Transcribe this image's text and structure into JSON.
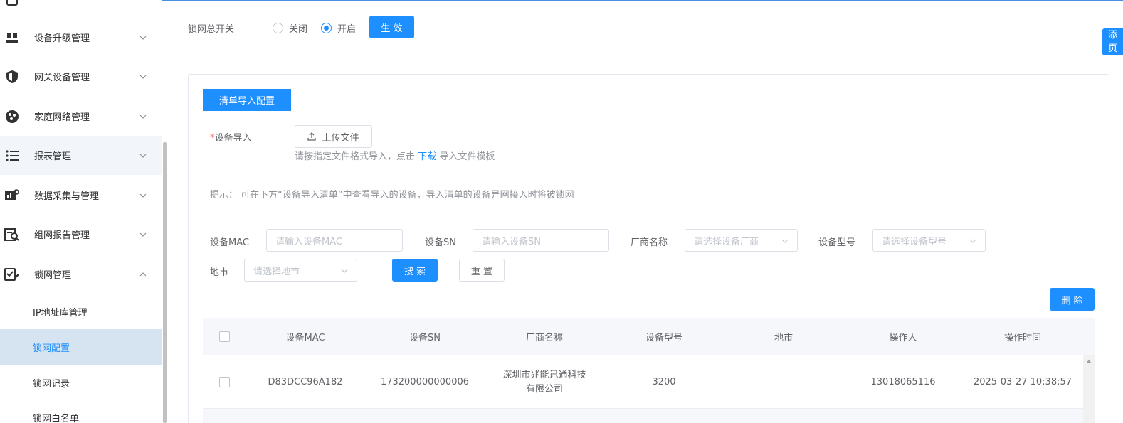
{
  "sidebar": {
    "items": [
      {
        "label": "设备升级管理",
        "icon": "package-icon"
      },
      {
        "label": "网关设备管理",
        "icon": "shield-icon"
      },
      {
        "label": "家庭网络管理",
        "icon": "network-icon"
      },
      {
        "label": "报表管理",
        "icon": "list-icon"
      },
      {
        "label": "数据采集与管理",
        "icon": "data-collect-icon"
      },
      {
        "label": "组网报告管理",
        "icon": "report-search-icon"
      },
      {
        "label": "锁网管理",
        "icon": "lock-config-icon"
      }
    ],
    "sub_items": [
      {
        "label": "IP地址库管理"
      },
      {
        "label": "锁网配置"
      },
      {
        "label": "锁网记录"
      },
      {
        "label": "锁网白名单"
      }
    ]
  },
  "lock_switch": {
    "label": "锁网总开关",
    "off_label": "关闭",
    "on_label": "开启",
    "selected": "开启",
    "apply_label": "生 效"
  },
  "side_tag": {
    "line1": "添",
    "line2": "页"
  },
  "import": {
    "tab_label": "清单导入配置",
    "required_mark": "*",
    "field_label": "设备导入",
    "upload_label": "上传文件",
    "hint_prefix": "请按指定文件格式导入，点击",
    "hint_link": "下载",
    "hint_suffix": "导入文件模板",
    "tip": "提示：  可在下方“设备导入清单”中查看导入的设备，导入清单的设备异网接入时将被锁网"
  },
  "filters": {
    "mac_label": "设备MAC",
    "mac_placeholder": "请输入设备MAC",
    "sn_label": "设备SN",
    "sn_placeholder": "请输入设备SN",
    "vendor_label": "厂商名称",
    "vendor_placeholder": "请选择设备厂商",
    "model_label": "设备型号",
    "model_placeholder": "请选择设备型号",
    "city_label": "地市",
    "city_placeholder": "请选择地市",
    "search_label": "搜 索",
    "reset_label": "重 置",
    "delete_label": "删 除"
  },
  "table": {
    "columns": [
      "设备MAC",
      "设备SN",
      "厂商名称",
      "设备型号",
      "地市",
      "操作人",
      "操作时间"
    ],
    "rows": [
      {
        "mac": "D83DCC96A182",
        "sn": "173200000000006",
        "vendor_line1": "深圳市兆能讯通科技",
        "vendor_line2": "有限公司",
        "model": "3200",
        "city": "",
        "operator": "13018065116",
        "time": "2025-03-27 10:38:57"
      }
    ]
  },
  "colors": {
    "primary": "#1e8fff",
    "active_bg": "#d6e3f0"
  }
}
